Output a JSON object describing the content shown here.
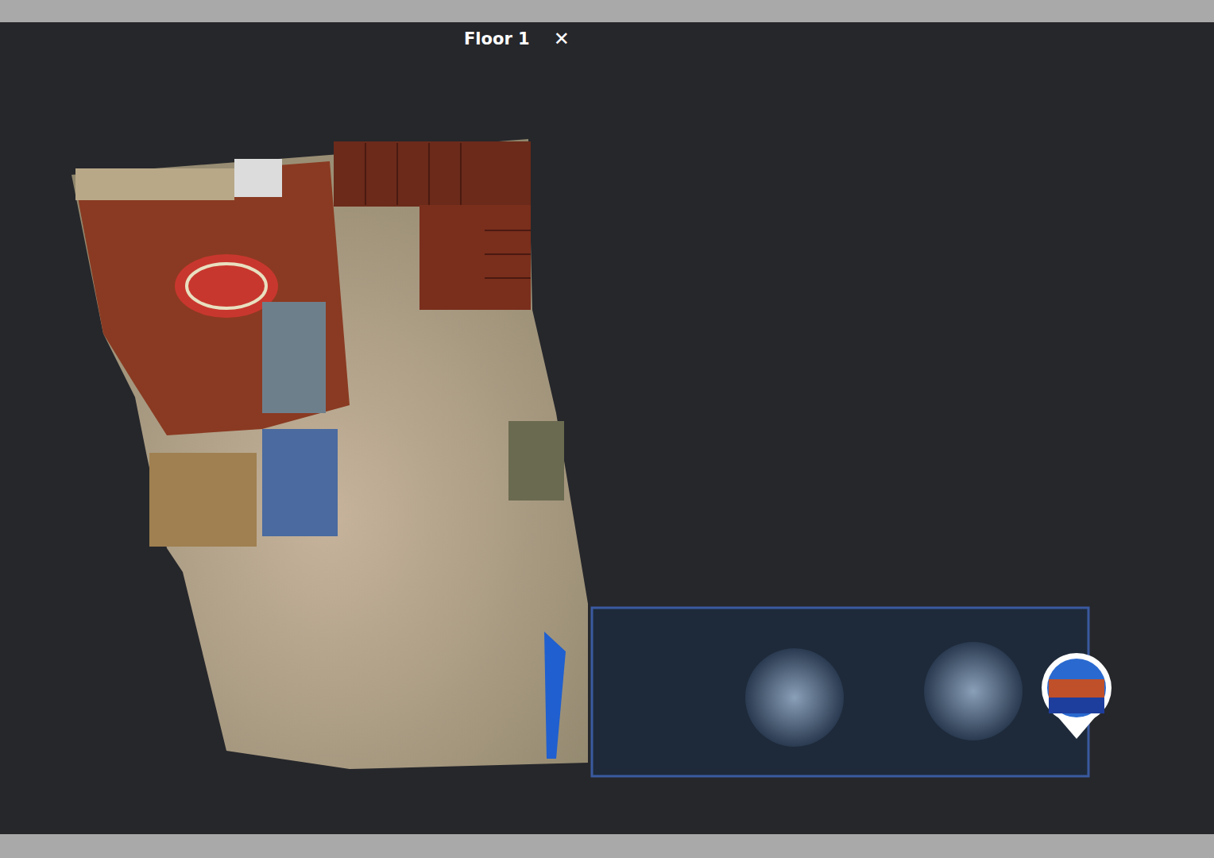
{
  "header": {
    "floor_label": "Floor 1",
    "close": "✕"
  }
}
